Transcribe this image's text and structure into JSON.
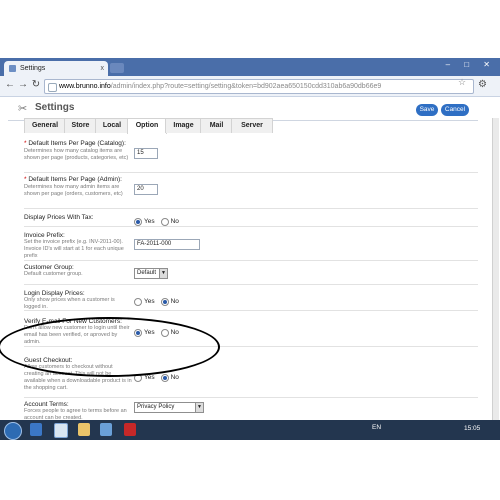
{
  "browser": {
    "tab_title": "Settings",
    "tab_close": "x",
    "window_buttons": "– □ ✕",
    "url_host": "www.brunno.info",
    "url_path": "/admin/index.php?route=setting/setting&token=bd902aea650150cdd310ab6a90db66e9"
  },
  "header": {
    "title": "Settings",
    "save_label": "Save",
    "cancel_label": "Cancel"
  },
  "tabs": [
    {
      "label": "General"
    },
    {
      "label": "Store"
    },
    {
      "label": "Local"
    },
    {
      "label": "Option"
    },
    {
      "label": "Image"
    },
    {
      "label": "Mail"
    },
    {
      "label": "Server"
    }
  ],
  "active_tab": "Option",
  "fields": {
    "items_catalog": {
      "label": "Default Items Per Page (Catalog):",
      "help": "Determines how many catalog items are shown per page (products, categories, etc)",
      "value": "15"
    },
    "items_admin": {
      "label": "Default Items Per Page (Admin):",
      "help": "Determines how many admin items are shown per page (orders, customers, etc)",
      "value": "20"
    },
    "prices_tax": {
      "label": "Display Prices With Tax:",
      "yes": "Yes",
      "no": "No",
      "selected": "Yes"
    },
    "invoice_prefix": {
      "label": "Invoice Prefix:",
      "help": "Set the invoice prefix (e.g. INV-2011-00). Invoice ID's will start at 1 for each unique prefix",
      "value": "FA-2011-000"
    },
    "customer_group": {
      "label": "Customer Group:",
      "help": "Default customer group.",
      "value": "Default"
    },
    "login_prices": {
      "label": "Login Display Prices:",
      "help": "Only show prices when a customer is logged in.",
      "yes": "Yes",
      "no": "No",
      "selected": "No"
    },
    "verify_email": {
      "label": "Verify E-mail For New Customers:",
      "help": "Don't allow new customer to login until their email has been verified, or aproved by admin.",
      "yes": "Yes",
      "no": "No",
      "selected": "Yes"
    },
    "guest_checkout": {
      "label": "Guest Checkout:",
      "help": "Allow customers to checkout without creating an account. This will not be available when a downloadable product is in the shopping cart.",
      "yes": "Yes",
      "no": "No",
      "selected": "No"
    },
    "account_terms": {
      "label": "Account Terms:",
      "help": "Forces people to agree to terms before an account can be created.",
      "value": "Privacy Policy"
    }
  },
  "taskbar": {
    "language": "EN",
    "clock": "15:05"
  },
  "colors": {
    "accent": "#2f6fc4",
    "taskbar": "#23364f"
  }
}
